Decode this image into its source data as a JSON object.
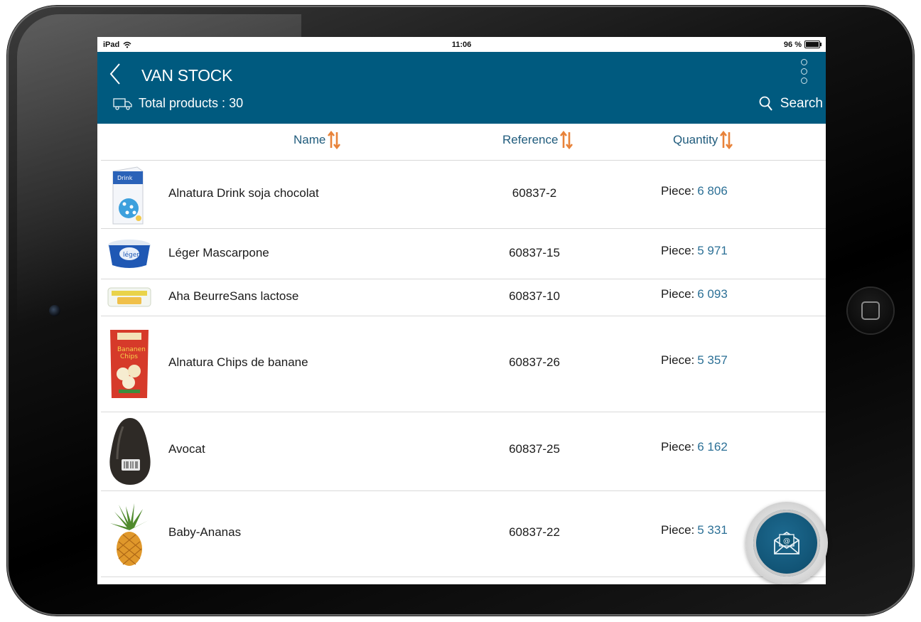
{
  "status": {
    "device": "iPad",
    "time": "11:06",
    "battery": "96 %"
  },
  "appbar": {
    "title": "VAN STOCK",
    "total_text": "Total products : 30",
    "search_label": "Search"
  },
  "columns": {
    "name": "Name",
    "reference": "Reference",
    "quantity": "Quantity"
  },
  "qty_prefix": "Piece:",
  "products": [
    {
      "name": "Alnatura Drink soja chocolat",
      "reference": "60837-2",
      "quantity": "6 806",
      "thumb": "drink-carton-icon"
    },
    {
      "name": "Léger Mascarpone",
      "reference": "60837-15",
      "quantity": "5 971",
      "thumb": "mascarpone-tub-icon"
    },
    {
      "name": "Aha BeurreSans lactose",
      "reference": "60837-10",
      "quantity": "6 093",
      "thumb": "butter-box-icon"
    },
    {
      "name": "Alnatura Chips de banane",
      "reference": "60837-26",
      "quantity": "5 357",
      "thumb": "chips-bag-icon"
    },
    {
      "name": "Avocat",
      "reference": "60837-25",
      "quantity": "6 162",
      "thumb": "avocado-icon"
    },
    {
      "name": "Baby-Ananas",
      "reference": "60837-22",
      "quantity": "5 331",
      "thumb": "pineapple-icon"
    }
  ],
  "colors": {
    "header": "#005a7f",
    "accent_sort": "#e8833a",
    "qty_number": "#2c7096"
  }
}
